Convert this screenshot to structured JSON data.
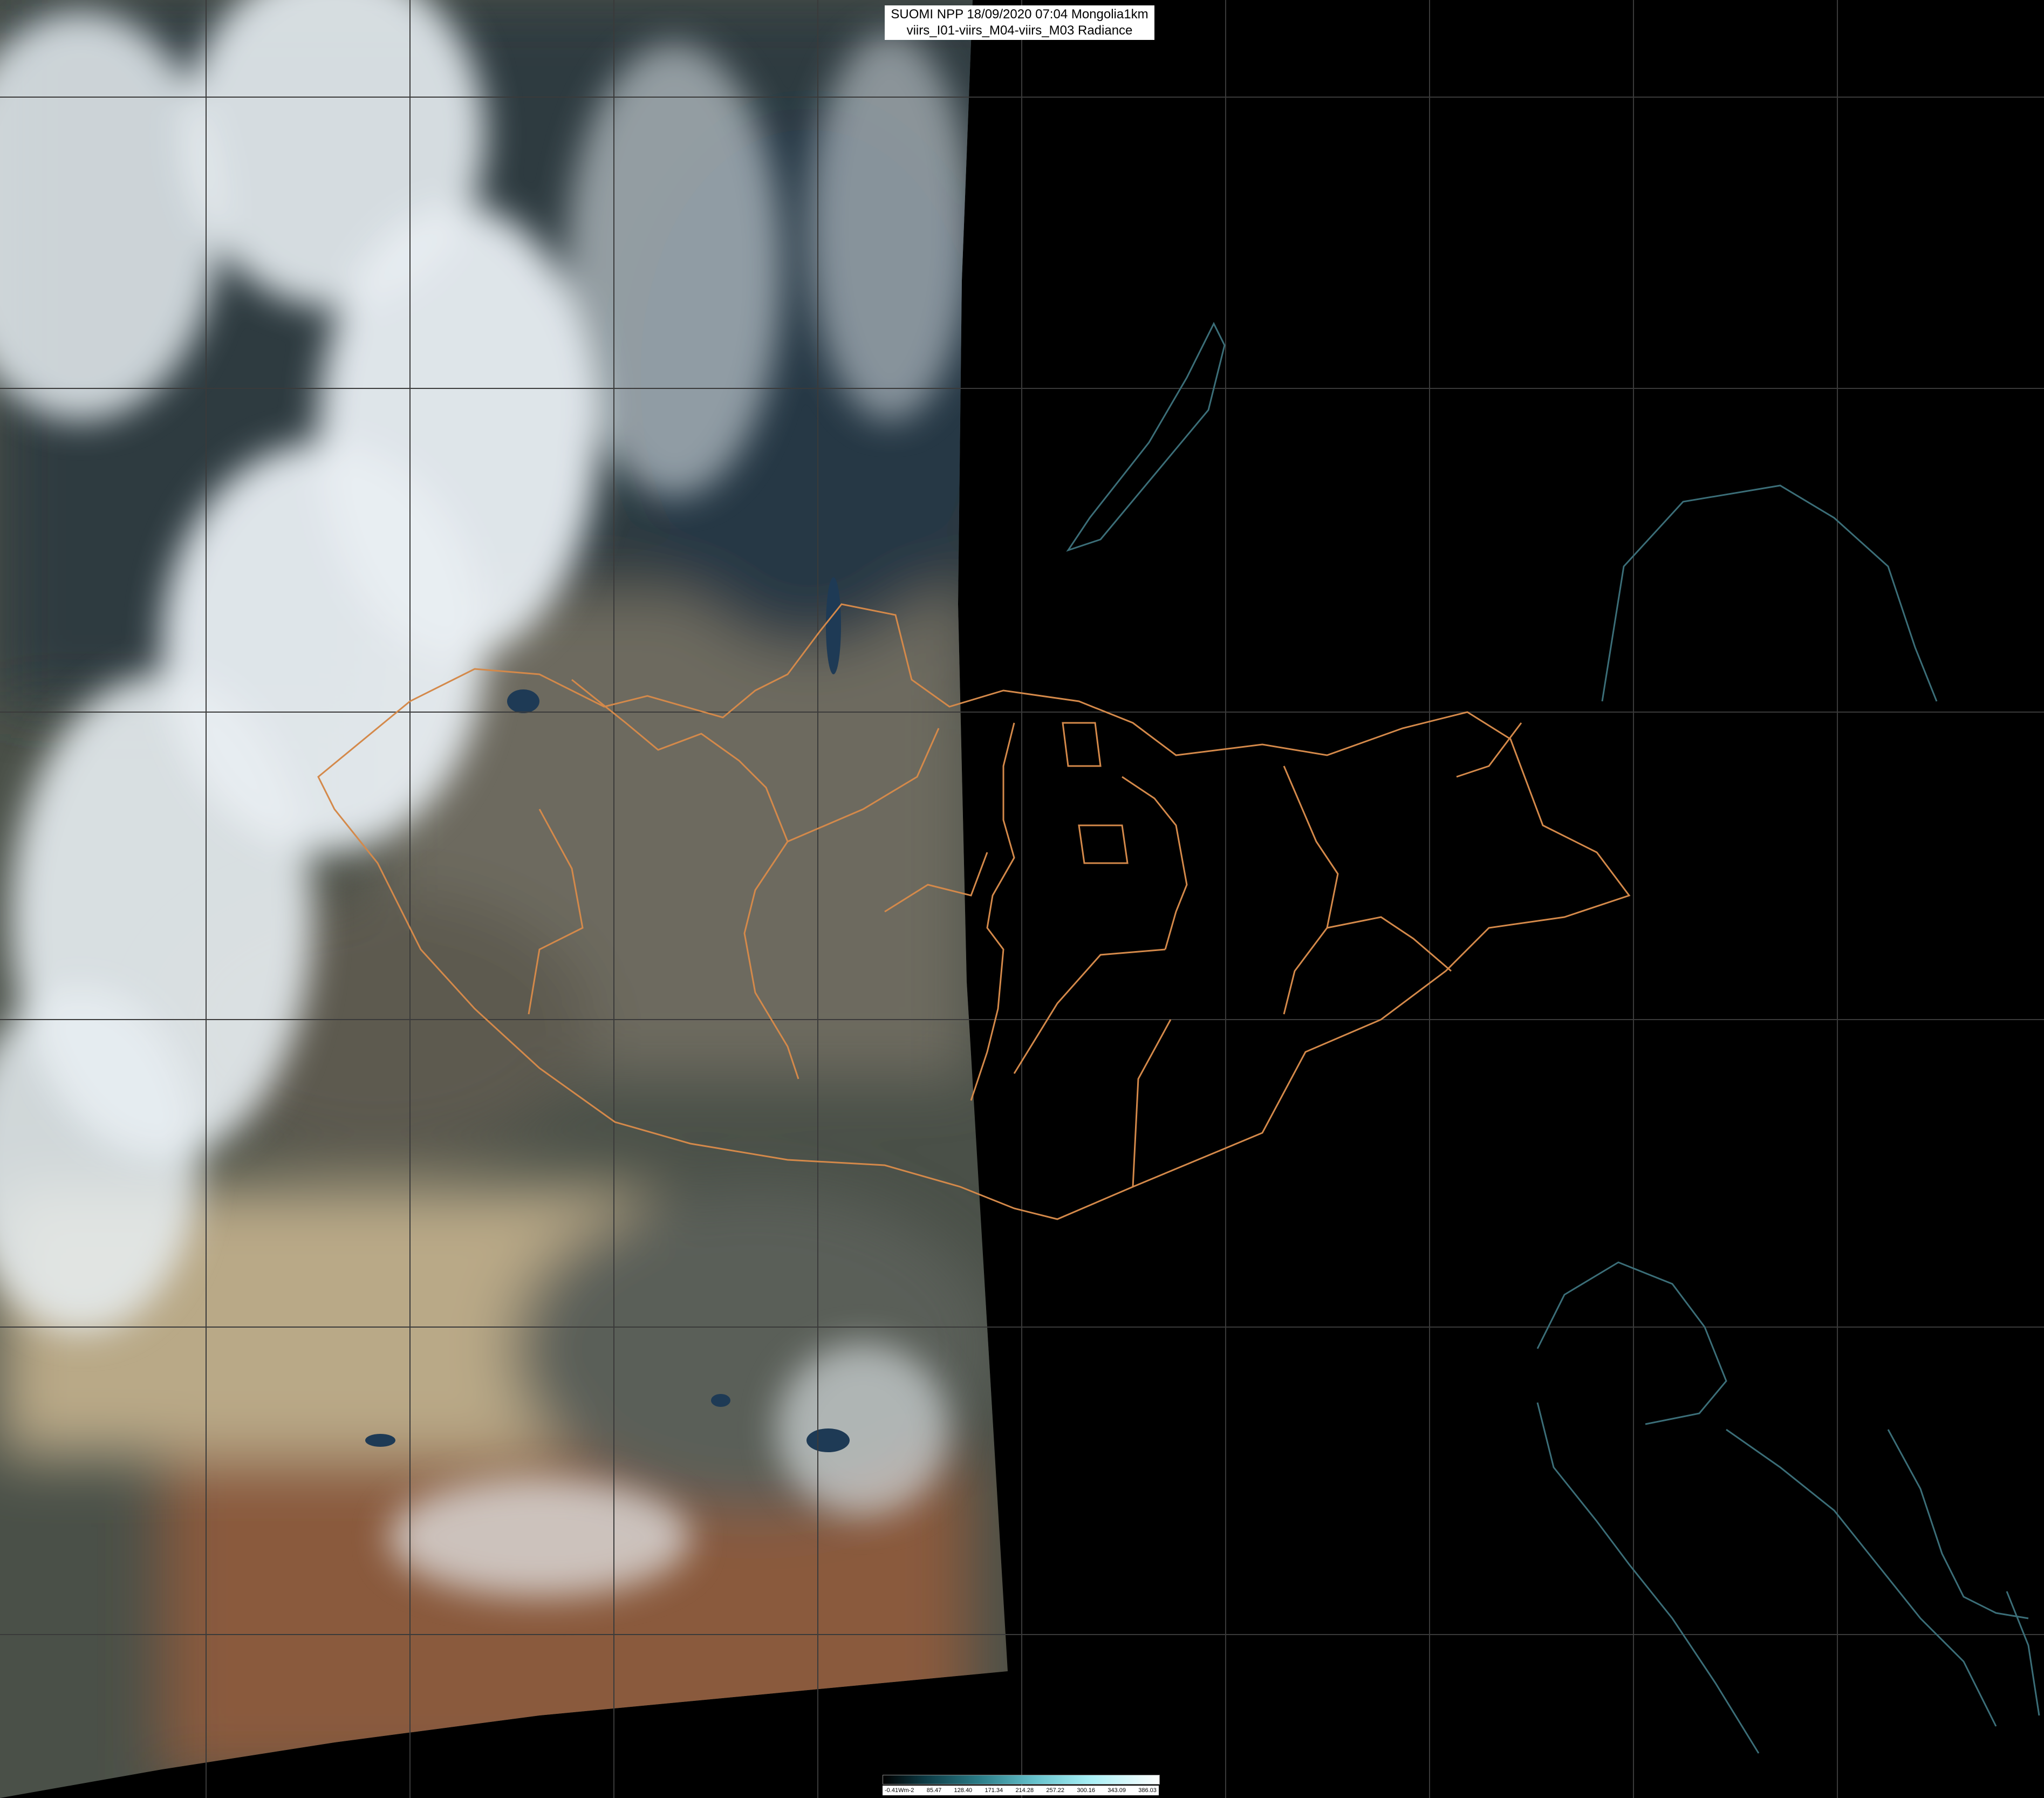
{
  "header": {
    "line1": "SUOMI NPP 18/09/2020 07:04 Mongolia1km",
    "line2": "viirs_I01-viirs_M04-viirs_M03 Radiance"
  },
  "colorbar": {
    "ticks": [
      "-0.41Wm-2",
      "85.47",
      "128.40",
      "171.34",
      "214.28",
      "257.22",
      "300.16",
      "343.09",
      "386.03"
    ]
  },
  "colors": {
    "background": "#000000",
    "admin_borders": "#d4894a",
    "coastlines": "#3b6e78",
    "graticule": "#3a3a3a",
    "cloud": "#e8eef2",
    "desert": "#b9a987",
    "terrain_dark": "#3c4438",
    "highland": "#8a5a3c"
  }
}
